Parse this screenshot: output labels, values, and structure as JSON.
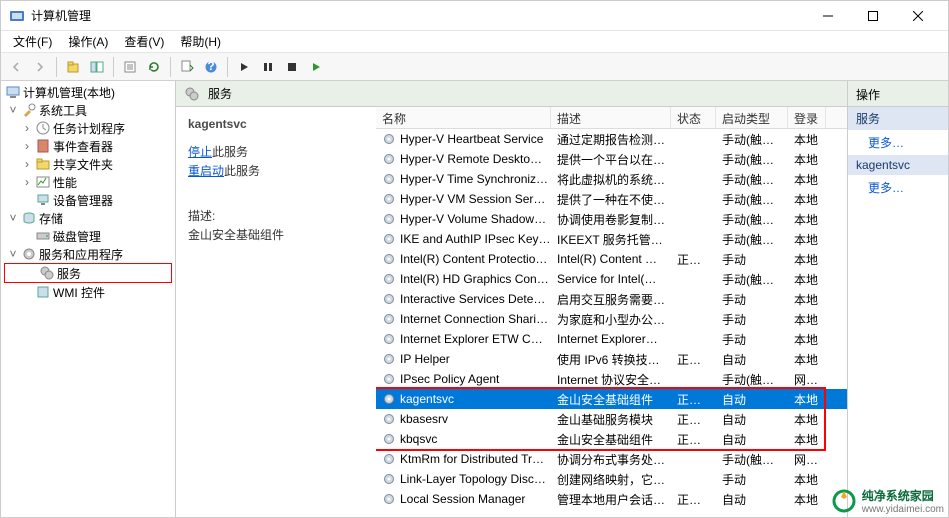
{
  "titlebar": {
    "title": "计算机管理"
  },
  "menubar": {
    "file": "文件(F)",
    "action": "操作(A)",
    "view": "查看(V)",
    "help": "帮助(H)"
  },
  "tree": {
    "root": "计算机管理(本地)",
    "systools": "系统工具",
    "sched": "任务计划程序",
    "eventvwr": "事件查看器",
    "shared": "共享文件夹",
    "perf": "性能",
    "devmgr": "设备管理器",
    "storage": "存储",
    "diskmgr": "磁盘管理",
    "svcapps": "服务和应用程序",
    "services": "服务",
    "wmi": "WMI 控件"
  },
  "svc": {
    "header": "服务",
    "sel_name": "kagentsvc",
    "stop_pre": "停止",
    "stop_suf": "此服务",
    "restart_pre": "重启动",
    "restart_suf": "此服务",
    "desc_label": "描述:",
    "desc_value": "金山安全基础组件"
  },
  "cols": {
    "name": "名称",
    "desc": "描述",
    "stat": "状态",
    "start": "启动类型",
    "logon": "登录"
  },
  "rows": [
    {
      "n": "Hyper-V Heartbeat Service",
      "d": "通过定期报告检测…",
      "s": "",
      "t": "手动(触发…",
      "l": "本地"
    },
    {
      "n": "Hyper-V Remote Deskto…",
      "d": "提供一个平台以在…",
      "s": "",
      "t": "手动(触发…",
      "l": "本地"
    },
    {
      "n": "Hyper-V Time Synchroniz…",
      "d": "将此虚拟机的系统…",
      "s": "",
      "t": "手动(触发…",
      "l": "本地"
    },
    {
      "n": "Hyper-V VM Session Ser…",
      "d": "提供了一种在不使…",
      "s": "",
      "t": "手动(触发…",
      "l": "本地"
    },
    {
      "n": "Hyper-V Volume Shadow…",
      "d": "协调使用卷影复制…",
      "s": "",
      "t": "手动(触发…",
      "l": "本地"
    },
    {
      "n": "IKE and AuthIP IPsec Key…",
      "d": "IKEEXT 服务托管…",
      "s": "",
      "t": "手动(触发…",
      "l": "本地"
    },
    {
      "n": "Intel(R) Content Protectio…",
      "d": "Intel(R) Content …",
      "s": "正在…",
      "t": "手动",
      "l": "本地"
    },
    {
      "n": "Intel(R) HD Graphics Con…",
      "d": "Service for Intel(…",
      "s": "",
      "t": "手动(触发…",
      "l": "本地"
    },
    {
      "n": "Interactive Services Dete…",
      "d": "启用交互服务需要…",
      "s": "",
      "t": "手动",
      "l": "本地"
    },
    {
      "n": "Internet Connection Shari…",
      "d": "为家庭和小型办公…",
      "s": "",
      "t": "手动",
      "l": "本地"
    },
    {
      "n": "Internet Explorer ETW C…",
      "d": "Internet Explorer…",
      "s": "",
      "t": "手动",
      "l": "本地"
    },
    {
      "n": "IP Helper",
      "d": "使用 IPv6 转换技…",
      "s": "正在…",
      "t": "自动",
      "l": "本地"
    },
    {
      "n": "IPsec Policy Agent",
      "d": "Internet 协议安全…",
      "s": "",
      "t": "手动(触发…",
      "l": "网络服"
    },
    {
      "n": "kagentsvc",
      "d": "金山安全基础组件",
      "s": "正在…",
      "t": "自动",
      "l": "本地",
      "sel": true
    },
    {
      "n": "kbasesrv",
      "d": "金山基础服务模块",
      "s": "正在…",
      "t": "自动",
      "l": "本地"
    },
    {
      "n": "kbqsvc",
      "d": "金山安全基础组件",
      "s": "正在…",
      "t": "自动",
      "l": "本地"
    },
    {
      "n": "KtmRm for Distributed Tr…",
      "d": "协调分布式事务处…",
      "s": "",
      "t": "手动(触发…",
      "l": "网络服"
    },
    {
      "n": "Link-Layer Topology Disc…",
      "d": "创建网络映射，它…",
      "s": "",
      "t": "手动",
      "l": "本地"
    },
    {
      "n": "Local Session Manager",
      "d": "管理本地用户会话…",
      "s": "正在…",
      "t": "自动",
      "l": "本地"
    }
  ],
  "actions": {
    "header": "操作",
    "sec1": "服务",
    "more1": "更多…",
    "sec2": "kagentsvc",
    "more2": "更多…"
  },
  "watermark": {
    "brand": "纯净系统家园",
    "url": "www.yidaimei.com"
  }
}
